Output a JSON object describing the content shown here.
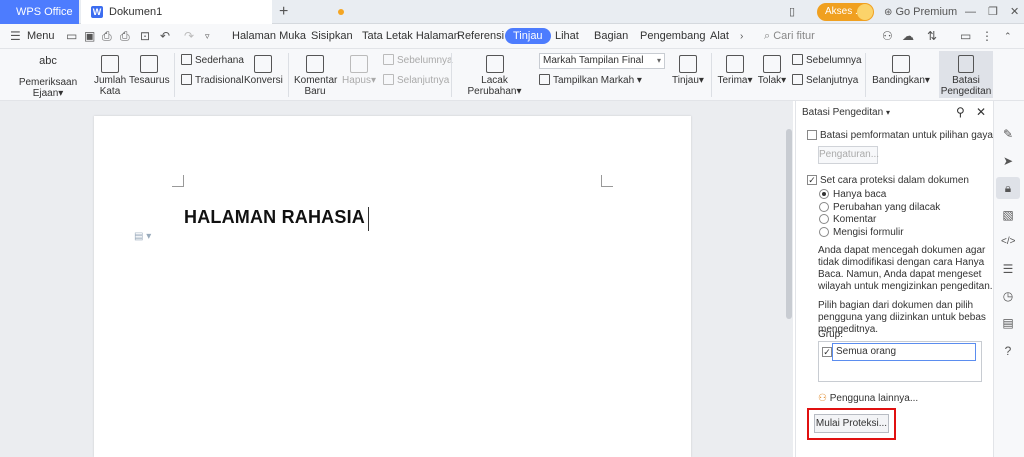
{
  "titlebar": {
    "app_tab": "WPS Office",
    "doc_tab": "Dokumen1",
    "new_tab": "+",
    "akses_label": "Akses ...",
    "go_premium": "Go Premium"
  },
  "menubar": {
    "menu_label": "Menu",
    "tabs": [
      "Halaman Muka",
      "Sisipkan",
      "Tata Letak Halaman",
      "Referensi",
      "Tinjau",
      "Lihat",
      "Bagian",
      "Pengembang",
      "Alat"
    ],
    "active_tab": "Tinjau",
    "search_placeholder": "Cari fitur"
  },
  "ribbon": {
    "pemeriksaan_ejaan": "Pemeriksaan Ejaan",
    "jumlah_kata_1": "Jumlah",
    "jumlah_kata_2": "Kata",
    "tesaurus": "Tesaurus",
    "sederhana": "Sederhana",
    "tradisional": "Tradisional",
    "konversi": "Konversi",
    "komentar_baru_1": "Komentar",
    "komentar_baru_2": "Baru",
    "hapus": "Hapus",
    "sebelumnya_1": "Sebelumnya",
    "selanjutnya_1": "Selanjutnya",
    "lacak_perubahan": "Lacak Perubahan",
    "markah_select": "Markah Tampilan Final",
    "tampilkan_markah": "Tampilkan Markah",
    "tinjau": "Tinjau",
    "terima": "Terima",
    "tolak": "Tolak",
    "sebelumnya_2": "Sebelumnya",
    "selanjutnya_2": "Selanjutnya",
    "bandingkan": "Bandingkan",
    "batasi_1": "Batasi",
    "batasi_2": "Pengeditan"
  },
  "document": {
    "title_text": "HALAMAN RAHASIA"
  },
  "panel": {
    "header": "Batasi Pengeditan",
    "format_label": "Batasi pemformatan untuk pilihan gaya",
    "pengaturan_button": "Pengaturan...",
    "protect_label": "Set cara proteksi dalam dokumen",
    "options": [
      "Hanya baca",
      "Perubahan yang dilacak",
      "Komentar",
      "Mengisi formulir"
    ],
    "selected_option": "Hanya baca",
    "desc1_lines": [
      "Anda dapat mencegah dokumen agar",
      "tidak dimodifikasi dengan cara Hanya",
      "Baca. Namun, Anda dapat mengeset",
      "wilayah untuk mengizinkan pengeditan."
    ],
    "desc2_lines": [
      "Pilih bagian dari dokumen dan pilih",
      "pengguna yang diizinkan untuk bebas",
      "mengeditnya."
    ],
    "grup_label": "Grup:",
    "group_entry": "Semua orang",
    "other_users": "Pengguna lainnya...",
    "start_button": "Mulai Proteksi..."
  }
}
